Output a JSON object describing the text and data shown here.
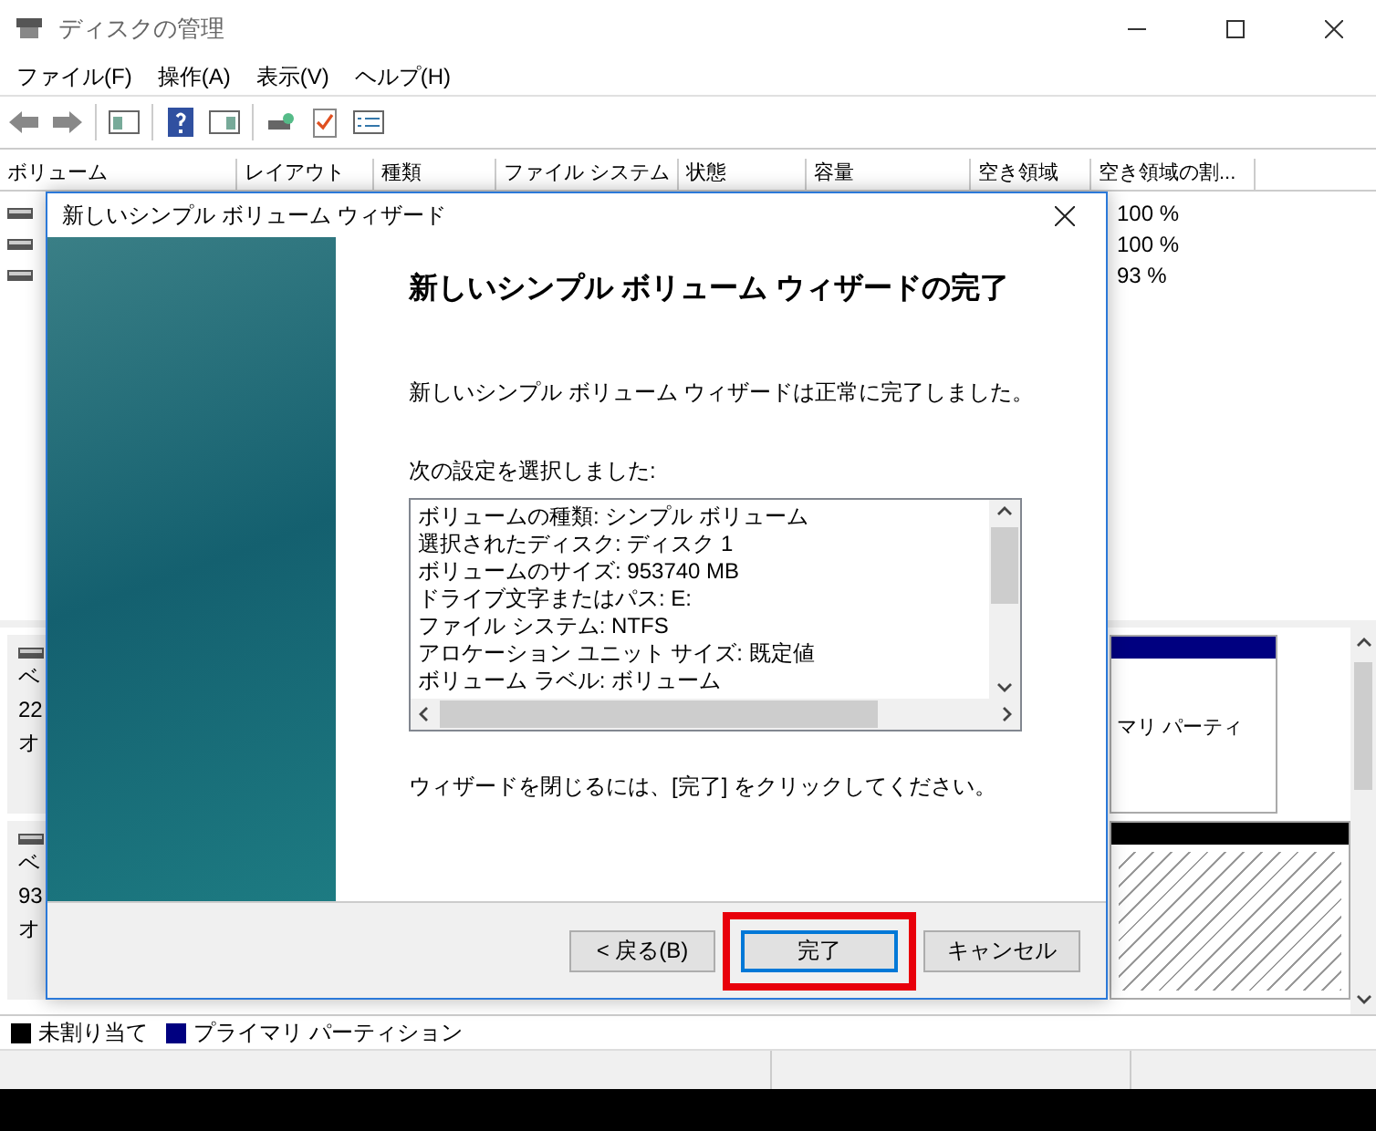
{
  "window": {
    "title": "ディスクの管理"
  },
  "menu": [
    "ファイル(F)",
    "操作(A)",
    "表示(V)",
    "ヘルプ(H)"
  ],
  "columns": [
    "ボリューム",
    "レイアウト",
    "種類",
    "ファイル システム",
    "状態",
    "容量",
    "空き領域",
    "空き領域の割..."
  ],
  "volume_rows": [
    {
      "free_percent": "100 %"
    },
    {
      "free_percent": "100 %"
    },
    {
      "free_percent": "93 %"
    }
  ],
  "disks": [
    {
      "lines": [
        "ベ",
        "22",
        "オ"
      ],
      "partitions": [
        {
          "kind": "primary",
          "label": "マリ パーティ"
        }
      ]
    },
    {
      "lines": [
        "ベ",
        "93",
        "オ"
      ],
      "partitions": [
        {
          "kind": "unallocated"
        }
      ]
    }
  ],
  "legend": [
    {
      "label": "未割り当て",
      "color": "#000000"
    },
    {
      "label": "プライマリ パーティション",
      "color": "#000080"
    }
  ],
  "dialog": {
    "title": "新しいシンプル ボリューム ウィザード",
    "heading": "新しいシンプル ボリューム ウィザードの完了",
    "message": "新しいシンプル ボリューム ウィザードは正常に完了しました。",
    "settings_label": "次の設定を選択しました:",
    "settings": [
      "ボリュームの種類: シンプル ボリューム",
      "選択されたディスク: ディスク 1",
      "ボリュームのサイズ: 953740 MB",
      "ドライブ文字またはパス: E:",
      "ファイル システム: NTFS",
      "アロケーション ユニット サイズ: 既定値",
      "ボリューム ラベル: ボリューム"
    ],
    "footer": "ウィザードを閉じるには、[完了] をクリックしてください。",
    "buttons": [
      {
        "label": "< 戻る(B)",
        "default": false,
        "highlighted": false
      },
      {
        "label": "完了",
        "default": true,
        "highlighted": true
      },
      {
        "label": "キャンセル",
        "default": false,
        "highlighted": false
      }
    ]
  }
}
